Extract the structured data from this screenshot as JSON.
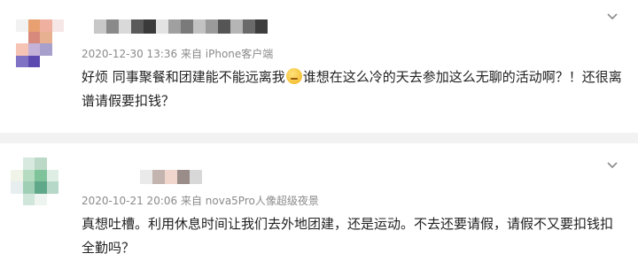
{
  "comments": [
    {
      "meta": "2020-12-30 13:36 来自 iPhone客户端",
      "text_before_emoji": "好烦 同事聚餐和团建能不能远离我",
      "emoji_icon": "sad-face-emoji",
      "text_after_emoji": "谁想在这么冷的天去参加这么无聊的活动啊？！还很离谱请假要扣钱？",
      "avatar_colors": [
        "#f2f2f2",
        "#e8a070",
        "#f0b0a0",
        "#f6e6e6",
        "#ffffff",
        "#d78a7b",
        "#e7b090",
        "#ffffff",
        "#f6c4b4",
        "#c5b2d8",
        "#a7a0cc",
        "#ffffff",
        "#7f72c4",
        "#5d4ab0",
        "#ffffff",
        "#ffffff"
      ],
      "name_colors": [
        "#ffffff",
        "#c8c8c8",
        "#8a8a8a",
        "#d9d9d9",
        "#5a5a5a",
        "#3a3a3a",
        "#e3e3e3",
        "#a0a0a0",
        "#7a7a7a",
        "#c2c2c2",
        "#9a9a9a",
        "#555555",
        "#b5b5b5",
        "#6a6a6a",
        "#3d3d3d"
      ]
    },
    {
      "meta": "2020-10-21 20:06 来自 nova5Pro人像超级夜景",
      "text": "真想吐槽。利用休息时间让我们去外地团建，还是运动。不去还要请假，请假不又要扣钱扣全勤吗？",
      "avatar_colors": [
        "#ffffff",
        "#d8e9e0",
        "#bcd8c6",
        "#ffffff",
        "#f0f4e8",
        "#b5dcc0",
        "#7fc39a",
        "#dfeee4",
        "#e6eef0",
        "#9fcfb5",
        "#5fa88a",
        "#b6d8c8",
        "#ffffff",
        "#d1e6da",
        "#eef4f0",
        "#ffffff"
      ],
      "name_colors": [
        "#eaeaea",
        "#c3b4b0",
        "#f0d6cc",
        "#9a8c88",
        "#d8d8d8"
      ]
    }
  ],
  "icons": {
    "more": "chevron-down-icon"
  }
}
